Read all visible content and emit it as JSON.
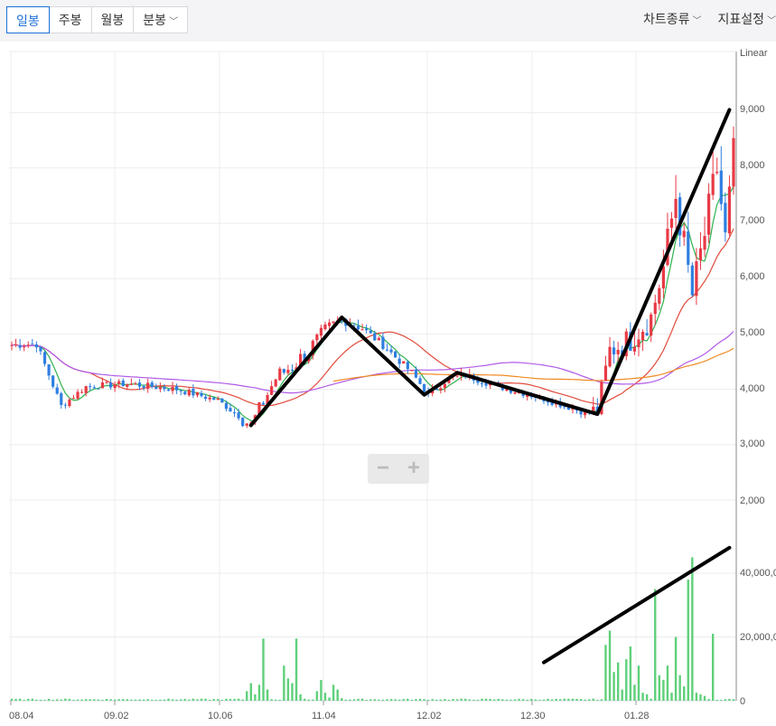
{
  "toolbar": {
    "tabs": [
      {
        "label": "일봉",
        "active": true
      },
      {
        "label": "주봉",
        "active": false
      },
      {
        "label": "월봉",
        "active": false
      },
      {
        "label": "분봉",
        "active": false,
        "dropdown": true
      }
    ],
    "right_menu": [
      {
        "label": "차트종류"
      },
      {
        "label": "지표설정"
      }
    ]
  },
  "zoom": {
    "minus": "−",
    "plus": "+"
  },
  "colors": {
    "up": "#e83a45",
    "down": "#2f7fe0",
    "volume": "#5fd07a",
    "ma5": "#2fb24d",
    "ma20": "#e24a3b",
    "ma60": "#b05ae8",
    "ma120": "#f08a24",
    "annotation": "#000000",
    "grid": "#ececec",
    "axis_text": "#555555"
  },
  "chart_data": [
    {
      "type": "candlestick",
      "scale_label": "Linear",
      "y_ticks": [
        "9,000",
        "8,000",
        "7,000",
        "6,000",
        "5,000",
        "4,000",
        "3,000",
        "2,000"
      ],
      "x_ticks": [
        "08.04",
        "09.02",
        "10.06",
        "11.04",
        "12.02",
        "12.30",
        "01.28"
      ],
      "ylim": [
        2000,
        9700
      ],
      "price_path": [
        [
          0,
          4800
        ],
        [
          6,
          4820
        ],
        [
          12,
          3700
        ],
        [
          18,
          4050
        ],
        [
          28,
          4100
        ],
        [
          40,
          4000
        ],
        [
          50,
          3800
        ],
        [
          58,
          3350
        ],
        [
          64,
          4200
        ],
        [
          70,
          4550
        ],
        [
          76,
          5000
        ],
        [
          80,
          5250
        ],
        [
          85,
          5100
        ],
        [
          90,
          4800
        ],
        [
          97,
          4300
        ],
        [
          101,
          3900
        ],
        [
          106,
          4200
        ],
        [
          110,
          4250
        ],
        [
          118,
          4050
        ],
        [
          128,
          3850
        ],
        [
          138,
          3600
        ],
        [
          142,
          3600
        ],
        [
          145,
          4700
        ],
        [
          150,
          4900
        ],
        [
          155,
          5300
        ],
        [
          158,
          6200
        ],
        [
          161,
          7500
        ],
        [
          165,
          5700
        ],
        [
          168,
          6800
        ],
        [
          171,
          8000
        ],
        [
          173,
          6700
        ],
        [
          175,
          8200
        ]
      ],
      "n_candles": 176,
      "moving_averages": [
        {
          "period": 5,
          "color": "#2fb24d"
        },
        {
          "period": 20,
          "color": "#e24a3b"
        },
        {
          "period": 60,
          "color": "#b05ae8"
        },
        {
          "period": 120,
          "color": "#f08a24"
        }
      ],
      "annotation_path": [
        [
          58,
          3350
        ],
        [
          80,
          5300
        ],
        [
          100,
          3900
        ],
        [
          108,
          4300
        ],
        [
          142,
          3550
        ],
        [
          174,
          9050
        ]
      ]
    },
    {
      "type": "bar",
      "name": "volume",
      "y_ticks": [
        "40,000,0",
        "20,000,0",
        "0"
      ],
      "ylim": [
        0,
        50000000
      ],
      "spikes": [
        {
          "i": 57,
          "v": 3000000
        },
        {
          "i": 58,
          "v": 5500000
        },
        {
          "i": 59,
          "v": 2000000
        },
        {
          "i": 60,
          "v": 5000000
        },
        {
          "i": 61,
          "v": 19500000
        },
        {
          "i": 62,
          "v": 3500000
        },
        {
          "i": 66,
          "v": 11000000
        },
        {
          "i": 67,
          "v": 7000000
        },
        {
          "i": 68,
          "v": 5500000
        },
        {
          "i": 69,
          "v": 19500000
        },
        {
          "i": 70,
          "v": 2000000
        },
        {
          "i": 74,
          "v": 3000000
        },
        {
          "i": 75,
          "v": 6500000
        },
        {
          "i": 76,
          "v": 2500000
        },
        {
          "i": 77,
          "v": 1000000
        },
        {
          "i": 78,
          "v": 5000000
        },
        {
          "i": 79,
          "v": 3500000
        },
        {
          "i": 80,
          "v": 800000
        },
        {
          "i": 144,
          "v": 17500000
        },
        {
          "i": 145,
          "v": 22000000
        },
        {
          "i": 146,
          "v": 9000000
        },
        {
          "i": 147,
          "v": 12000000
        },
        {
          "i": 148,
          "v": 3500000
        },
        {
          "i": 149,
          "v": 13000000
        },
        {
          "i": 150,
          "v": 17000000
        },
        {
          "i": 151,
          "v": 5000000
        },
        {
          "i": 152,
          "v": 11000000
        },
        {
          "i": 153,
          "v": 2500000
        },
        {
          "i": 154,
          "v": 2000000
        },
        {
          "i": 156,
          "v": 35000000
        },
        {
          "i": 157,
          "v": 8000000
        },
        {
          "i": 158,
          "v": 6500000
        },
        {
          "i": 159,
          "v": 11000000
        },
        {
          "i": 160,
          "v": 2500000
        },
        {
          "i": 161,
          "v": 20000000
        },
        {
          "i": 162,
          "v": 8000000
        },
        {
          "i": 163,
          "v": 4500000
        },
        {
          "i": 164,
          "v": 38000000
        },
        {
          "i": 165,
          "v": 45000000
        },
        {
          "i": 166,
          "v": 2500000
        },
        {
          "i": 167,
          "v": 2000000
        },
        {
          "i": 168,
          "v": 1500000
        },
        {
          "i": 170,
          "v": 21000000
        }
      ],
      "annotation_line": [
        [
          129,
          12000000
        ],
        [
          174,
          48000000
        ]
      ]
    }
  ]
}
